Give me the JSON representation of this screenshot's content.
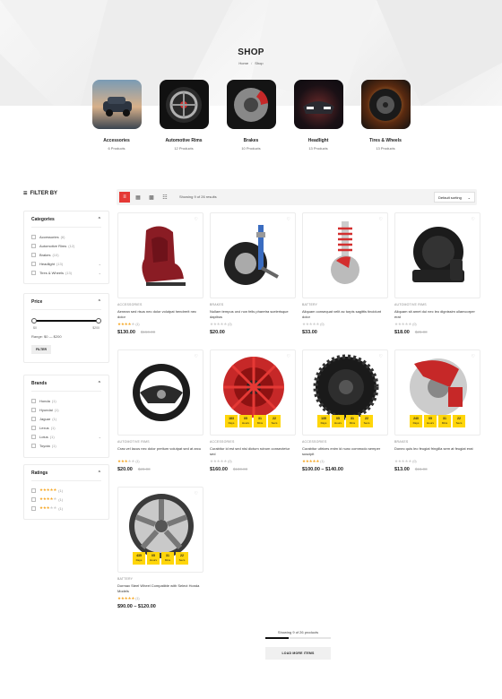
{
  "page": {
    "title": "SHOP",
    "breadcrumb": [
      "Home",
      "Shop"
    ]
  },
  "categories": [
    {
      "name": "Accessories",
      "count": "6 Products",
      "icon": "suv-car-image"
    },
    {
      "name": "Automotive Rims",
      "count": "12 Products",
      "icon": "rim-image"
    },
    {
      "name": "Brakes",
      "count": "10 Products",
      "icon": "brake-disc-image"
    },
    {
      "name": "Headlight",
      "count": "13 Products",
      "icon": "headlight-image"
    },
    {
      "name": "Tires & Wheels",
      "count": "13 Products",
      "icon": "tire-image"
    }
  ],
  "sidebar": {
    "filter_label": "FILTER BY",
    "categories_title": "Categories",
    "categories": [
      {
        "label": "Accessories",
        "count": "(6)"
      },
      {
        "label": "Automotive Rims",
        "count": "(12)"
      },
      {
        "label": "Brakes",
        "count": "(10)"
      },
      {
        "label": "Headlight",
        "count": "(13)"
      },
      {
        "label": "Tires & Wheels",
        "count": "(13)"
      }
    ],
    "price_title": "Price",
    "price_min_label": "$0",
    "price_max_label": "$200",
    "price_range": "Range: $0 — $200",
    "filter_button": "FILTER",
    "brands_title": "Brands",
    "brands": [
      {
        "label": "Honda",
        "count": "(1)"
      },
      {
        "label": "Hyundai",
        "count": "(1)"
      },
      {
        "label": "Jaguar",
        "count": "(1)"
      },
      {
        "label": "Lexus",
        "count": "(1)"
      },
      {
        "label": "Lotus",
        "count": "(1)"
      },
      {
        "label": "Toyota",
        "count": "(1)"
      }
    ],
    "ratings_title": "Ratings",
    "ratings": [
      {
        "stars": 5,
        "count": "(1)"
      },
      {
        "stars": 4,
        "count": "(1)"
      },
      {
        "stars": 3,
        "count": "(1)"
      }
    ]
  },
  "toolbar": {
    "showing": "Showing 9 of 26 results",
    "sort": "Default sorting"
  },
  "products": [
    {
      "cat": "ACCESSORIES",
      "name": "Aenean sed risus nec dolor volutpat hendrerit nec dolor",
      "rating": 4,
      "rcount": "(1)",
      "price": "$130.00",
      "old": "$150.00"
    },
    {
      "cat": "BRAKES",
      "name": "Nullam tempus orci non felis pharetra scelerisque dapibus",
      "rating": 0,
      "rcount": "(0)",
      "price": "$20.00",
      "old": ""
    },
    {
      "cat": "BATTERY",
      "name": "Aliquam consequat velit ac turpis sagittis tincidunt dolor",
      "rating": 0,
      "rcount": "(0)",
      "price": "$33.00",
      "old": ""
    },
    {
      "cat": "AUTOMOTIVE RIMS",
      "name": "Aliquam sit amet dui nec leo dignissim ullamcorper erat",
      "rating": 0,
      "rcount": "(0)",
      "price": "$18.00",
      "old": "$25.00"
    },
    {
      "cat": "AUTOMOTIVE RIMS",
      "name": "Cras vel lacus nec dolor pretium volutpat sed at arcu",
      "rating": 3,
      "rcount": "(1)",
      "price": "$20.00",
      "old": "$28.00"
    },
    {
      "cat": "ACCESSORIES",
      "name": "Curabitur id est sed nisi dictum rutrum consectetur sed",
      "rating": 0,
      "rcount": "(0)",
      "price": "$160.00",
      "old": "$180.00"
    },
    {
      "cat": "ACCESSORIES",
      "name": "Curabitur ultrices enim id nunc commodo semper suscipit",
      "rating": 5,
      "rcount": "(1)",
      "price": "$100.00 – $140.00",
      "old": ""
    },
    {
      "cat": "BRAKES",
      "name": "Donec quis leo feugiat fringilla sem at feugiat erat",
      "rating": 0,
      "rcount": "(0)",
      "price": "$13.00",
      "old": "$15.00"
    },
    {
      "cat": "BATTERY",
      "name": "Dormax Steel Wheel Compatible with Select Honda Models",
      "rating": 5,
      "rcount": "(1)",
      "price": "$90.00 – $120.00",
      "old": ""
    }
  ],
  "countdowns": {
    "p6": [
      {
        "v": "183",
        "u": "Days"
      },
      {
        "v": "05",
        "u": "Hours"
      },
      {
        "v": "31",
        "u": "Mins"
      },
      {
        "v": "22",
        "u": "Secs"
      }
    ],
    "p7": [
      {
        "v": "135",
        "u": "Days"
      },
      {
        "v": "05",
        "u": "Hours"
      },
      {
        "v": "31",
        "u": "Mins"
      },
      {
        "v": "22",
        "u": "Secs"
      }
    ],
    "p8": [
      {
        "v": "240",
        "u": "Days"
      },
      {
        "v": "05",
        "u": "Hours"
      },
      {
        "v": "31",
        "u": "Mins"
      },
      {
        "v": "22",
        "u": "Secs"
      }
    ],
    "p9": [
      {
        "v": "435",
        "u": "Days"
      },
      {
        "v": "05",
        "u": "Hours"
      },
      {
        "v": "31",
        "u": "Mins"
      },
      {
        "v": "22",
        "u": "Secs"
      }
    ]
  },
  "pagination": {
    "showing": "Showing 9 of 26 products",
    "progress": 0.35,
    "load_more": "LOAD MORE ITEMS"
  },
  "colors": {
    "accent": "#e53935",
    "countdown": "#ffd60a",
    "star": "#f5a623"
  }
}
